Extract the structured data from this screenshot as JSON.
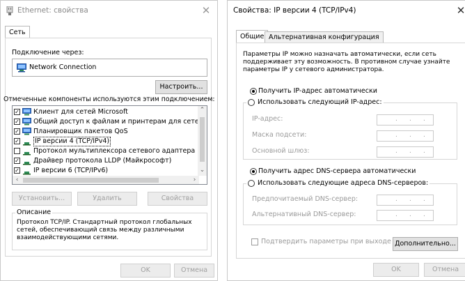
{
  "left_window": {
    "title": "Ethernet: свойства",
    "tab_network": "Сеть",
    "connect_using_label": "Подключение через:",
    "adapter_name": "Network Connection",
    "configure_button": "Настроить...",
    "components_label": "Отмеченные компоненты используются этим подключением:",
    "components": [
      {
        "label": "Клиент для сетей Microsoft",
        "checked": true,
        "icon": "network-client-icon"
      },
      {
        "label": "Общий доступ к файлам и принтерам для сетей Mi",
        "checked": true,
        "icon": "network-share-icon"
      },
      {
        "label": "Планировщик пакетов QoS",
        "checked": true,
        "icon": "network-service-icon"
      },
      {
        "label": "IP версии 4 (TCP/IPv4)",
        "checked": true,
        "icon": "protocol-icon",
        "selected": true
      },
      {
        "label": "Протокол мультиплексора сетевого адаптера (Ma",
        "checked": false,
        "icon": "protocol-icon"
      },
      {
        "label": "Драйвер протокола LLDP (Майкрософт)",
        "checked": true,
        "icon": "protocol-icon"
      },
      {
        "label": "IP версии 6 (TCP/IPv6)",
        "checked": true,
        "icon": "protocol-icon"
      }
    ],
    "install_button": "Установить...",
    "uninstall_button": "Удалить",
    "properties_button": "Свойства",
    "description_legend": "Описание",
    "description_text": "Протокол TCP/IP. Стандартный протокол глобальных сетей, обеспечивающий связь между различными взаимодействующими сетями.",
    "ok_button": "OK",
    "cancel_button": "Отмена"
  },
  "right_window": {
    "title": "Свойства: IP версии 4 (TCP/IPv4)",
    "tab_general": "Общие",
    "tab_alternate": "Альтернативная конфигурация",
    "intro_text": "Параметры IP можно назначать автоматически, если сеть поддерживает эту возможность. В противном случае узнайте параметры IP у сетевого администратора.",
    "radio_auto_ip": "Получить IP-адрес автоматически",
    "radio_manual_ip": "Использовать следующий IP-адрес:",
    "ip_address_label": "IP-адрес:",
    "subnet_mask_label": "Маска подсети:",
    "gateway_label": "Основной шлюз:",
    "radio_auto_dns": "Получить адрес DNS-сервера автоматически",
    "radio_manual_dns": "Использовать следующие адреса DNS-серверов:",
    "preferred_dns_label": "Предпочитаемый DNS-сервер:",
    "alternate_dns_label": "Альтернативный DNS-сервер:",
    "validate_on_exit": "Подтвердить параметры при выходе",
    "advanced_button": "Дополнительно...",
    "ok_button": "OK",
    "cancel_button": "Отмена",
    "ip_dots": ".",
    "auto_ip_selected": true,
    "auto_dns_selected": true
  },
  "colors": {
    "accent": "#0078d7",
    "disabled_text": "#9a9a9a",
    "adapter_icon": "#3a7bd5",
    "protocol_icon": "#2e8b57"
  }
}
